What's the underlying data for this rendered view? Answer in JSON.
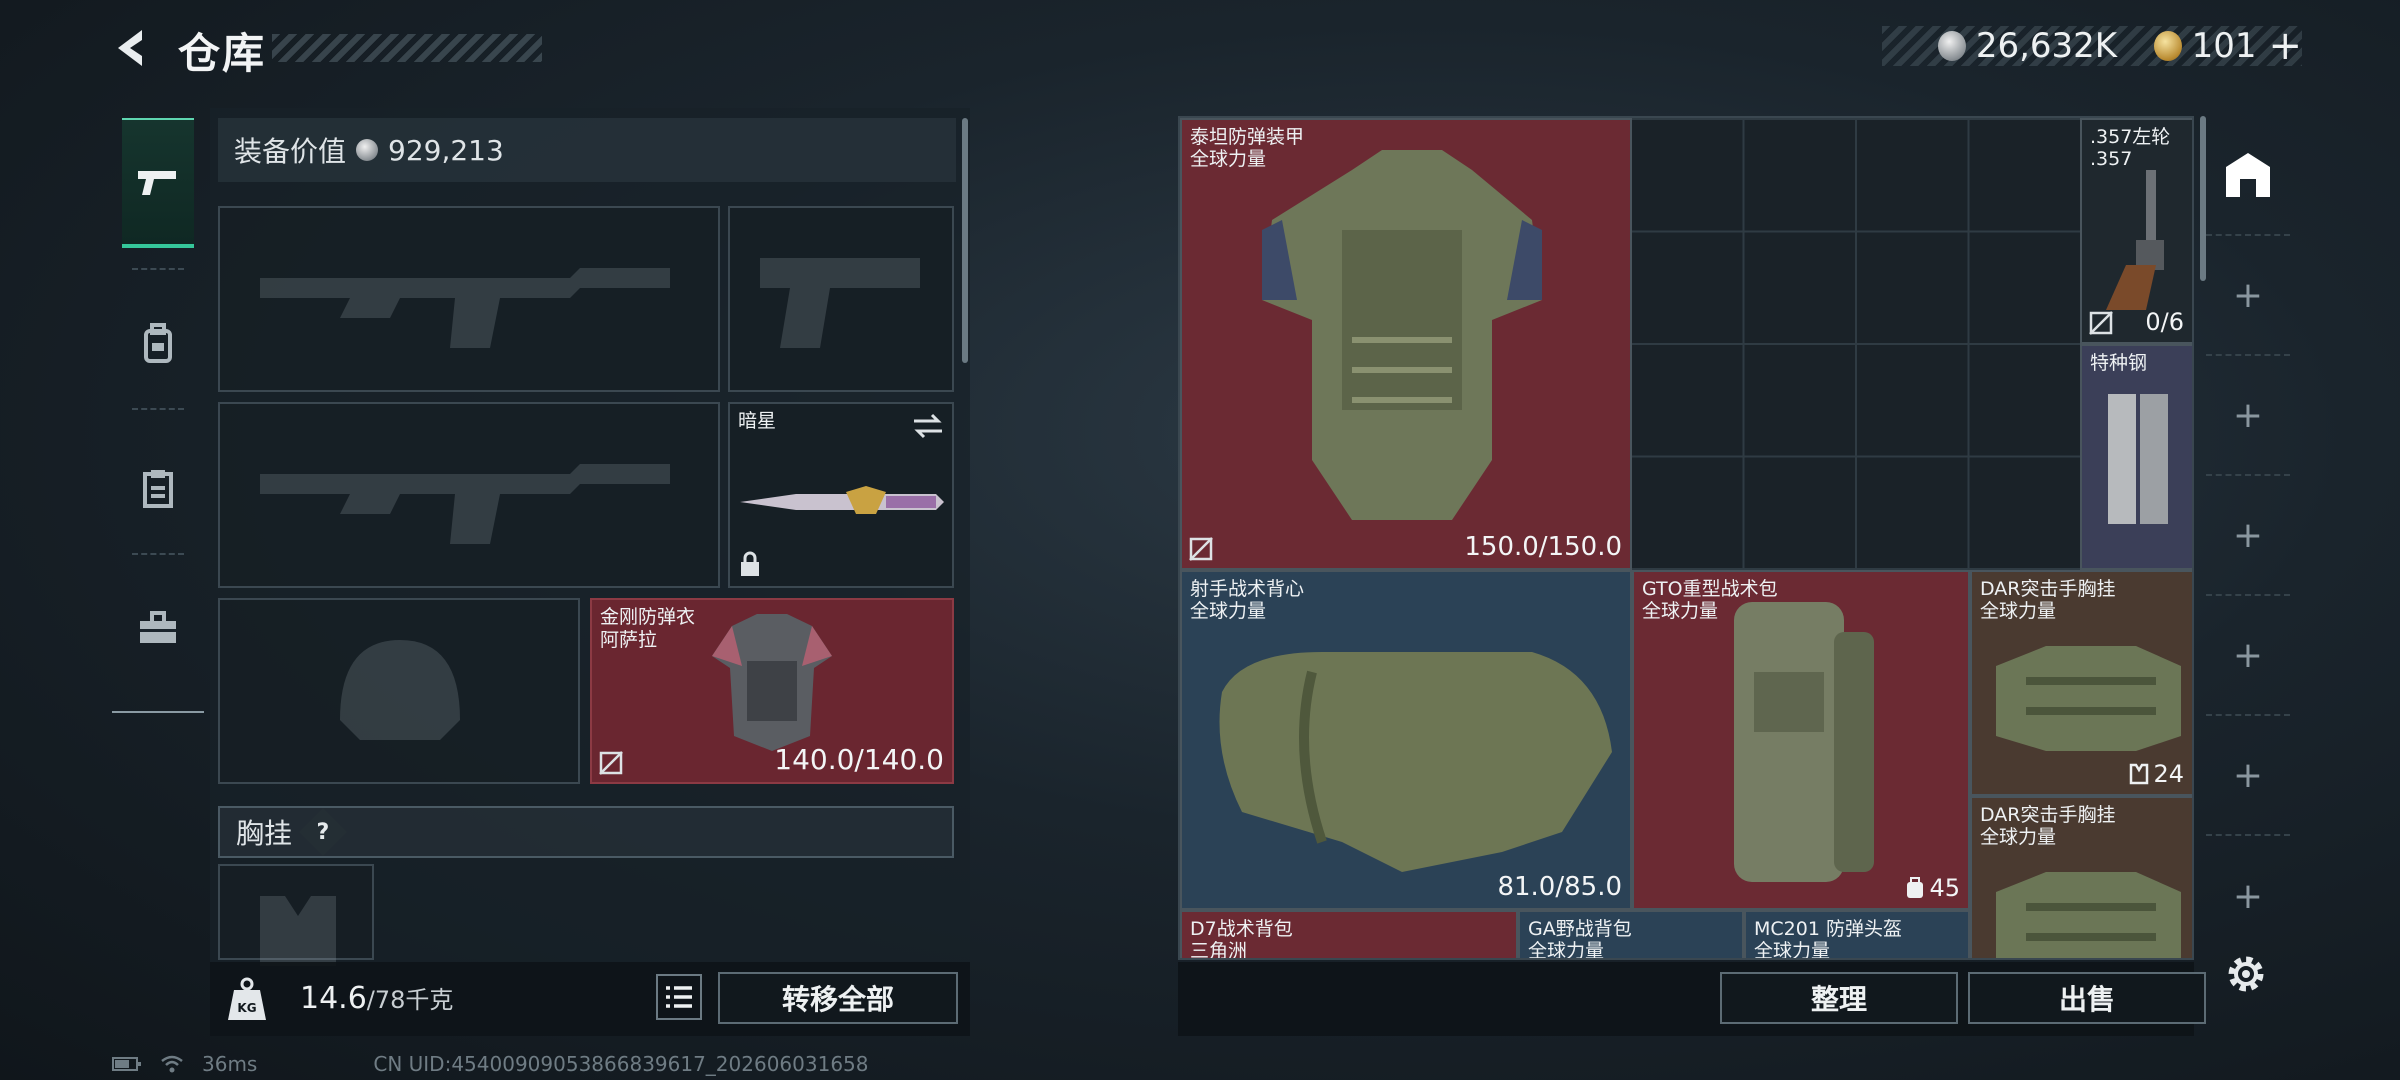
{
  "header": {
    "title": "仓库",
    "currency_silver": "26,632K",
    "currency_gold": "101",
    "gold_add": "+"
  },
  "left_panel": {
    "equip_value_label": "装备价值",
    "equip_value": "929,213",
    "melee_slot": {
      "name": "暗星"
    },
    "armor_slot": {
      "name_line1": "金刚防弹衣",
      "name_line2": "阿萨拉",
      "durability": "140.0/140.0"
    },
    "chest_rig_label": "胸挂",
    "help": "?",
    "weight_value": "14.6",
    "weight_max": "/78千克",
    "transfer_all": "转移全部"
  },
  "grid_items": [
    {
      "name": "泰坦防弹装甲",
      "sub": "全球力量",
      "durability": "150.0/150.0"
    },
    {
      "name": ".357左轮",
      "sub": ".357",
      "ammo": "0/6"
    },
    {
      "name": "特种钢"
    },
    {
      "name": "射手战术背心",
      "sub": "全球力量",
      "durability": "81.0/85.0"
    },
    {
      "name": "GTO重型战术包",
      "sub": "全球力量",
      "count": "45"
    },
    {
      "name": "DAR突击手胸挂",
      "sub": "全球力量",
      "count": "24"
    },
    {
      "name": "DAR突击手胸挂",
      "sub": "全球力量"
    },
    {
      "name": "D7战术背包",
      "sub": "三角洲"
    },
    {
      "name": "GA野战背包",
      "sub": "全球力量"
    },
    {
      "name": "MC201 防弹头盔",
      "sub": "全球力量"
    }
  ],
  "buttons": {
    "organize": "整理",
    "sell": "出售"
  },
  "right_sidebar": {
    "add": "+"
  },
  "footer": {
    "ping": "36ms",
    "uid": "CN UID:45400909053866839617_202606031658"
  },
  "colors": {
    "accent_green": "#35c79a",
    "rarity_red": "#6b2a33",
    "rarity_blue": "#2b4256",
    "rarity_brown": "#4a3a30",
    "rarity_violet": "#3b3f58"
  },
  "icons": [
    "back-arrow-icon",
    "pistol-icon",
    "backpack-icon",
    "clipboard-icon",
    "toolbox-icon",
    "silver-coin-icon",
    "gold-coin-icon",
    "swap-icon",
    "lock-icon",
    "no-insure-icon",
    "kg-weight-icon",
    "list-icon",
    "home-icon",
    "settings-icon",
    "wifi-icon",
    "battery-icon"
  ]
}
